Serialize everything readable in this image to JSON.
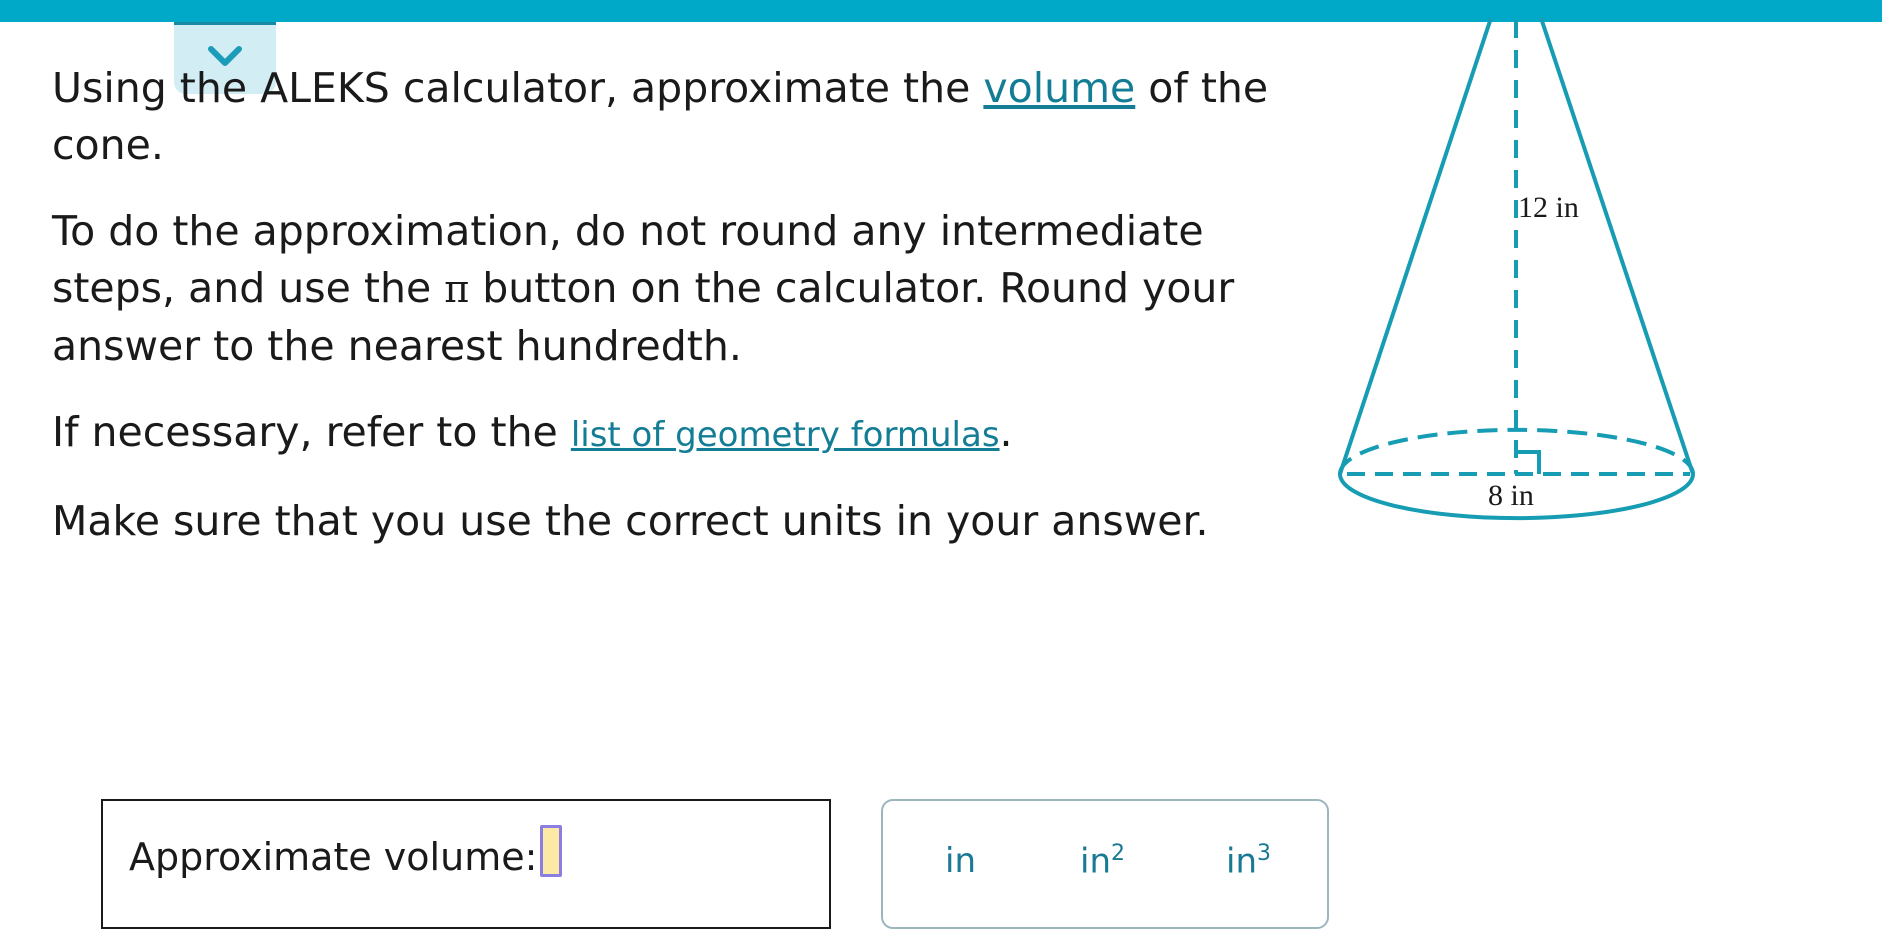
{
  "header": {
    "collapse_icon": "chevron-down-icon",
    "accent_color": "#00a9c8"
  },
  "question": {
    "p1_a": "Using the ALEKS calculator, approximate the ",
    "p1_link": "volume",
    "p1_b": " of the cone.",
    "p2_a": "To do the approximation, do not round any intermediate steps, and use the ",
    "p2_pi": "π",
    "p2_b": " button on the calculator. Round your answer to the nearest hundredth.",
    "p3_a": "If necessary, refer to the ",
    "p3_link": "list of geometry formulas",
    "p3_b": ".",
    "p4": "Make sure that you use the correct units in your answer."
  },
  "figure": {
    "height_label": "12 in",
    "radius_label": "8 in",
    "stroke_color": "#169cb3"
  },
  "answer": {
    "label": "Approximate volume:",
    "value": ""
  },
  "units": {
    "in": "in",
    "in2_base": "in",
    "in2_exp": "2",
    "in3_base": "in",
    "in3_exp": "3"
  }
}
